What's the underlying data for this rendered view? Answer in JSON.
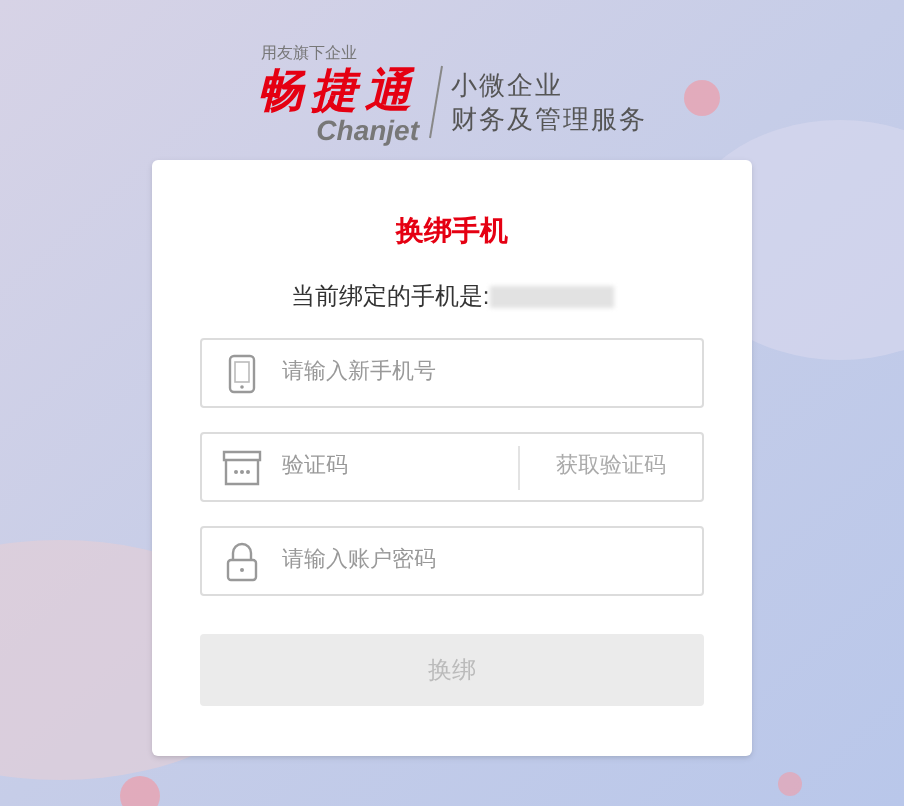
{
  "logo": {
    "parent": "用友旗下企业",
    "brand": "畅捷通",
    "brand_en": "Chanjet",
    "tagline": [
      "小微企业",
      "财务及管理服务"
    ]
  },
  "card": {
    "title": "换绑手机",
    "current_label": "当前绑定的手机是:",
    "fields": [
      {
        "kind": "phone",
        "placeholder": "请输入新手机号"
      },
      {
        "kind": "code",
        "placeholder": "验证码",
        "action": "获取验证码"
      },
      {
        "kind": "password",
        "placeholder": "请输入账户密码"
      }
    ],
    "submit": {
      "label": "换绑",
      "disabled": true
    }
  }
}
